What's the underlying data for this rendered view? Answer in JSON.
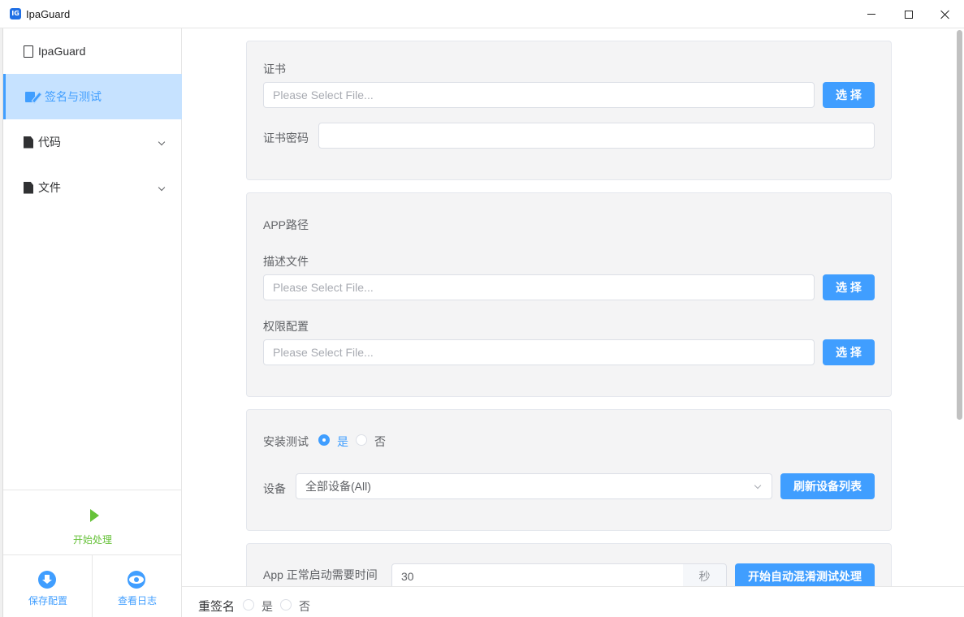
{
  "window": {
    "title": "IpaGuard",
    "logo_text": "IG"
  },
  "sidebar": {
    "items": [
      {
        "label": "IpaGuard"
      },
      {
        "label": "签名与测试"
      },
      {
        "label": "代码"
      },
      {
        "label": "文件"
      }
    ],
    "start_label": "开始处理",
    "save_label": "保存配置",
    "log_label": "查看日志"
  },
  "certificate": {
    "title": "证书",
    "file_placeholder": "Please Select File...",
    "select_button": "选 择",
    "password_label": "证书密码",
    "password_value": ""
  },
  "app_path": {
    "title": "APP路径",
    "profile_label": "描述文件",
    "profile_placeholder": "Please Select File...",
    "profile_button": "选 择",
    "entitlements_label": "权限配置",
    "entitlements_placeholder": "Please Select File...",
    "entitlements_button": "选 择"
  },
  "install_test": {
    "label": "安装测试",
    "yes": "是",
    "no": "否",
    "selected": "yes",
    "device_label": "设备",
    "device_value": "全部设备(All)",
    "refresh_button": "刷新设备列表"
  },
  "auto_test": {
    "startup_label": "App 正常启动需要时间",
    "startup_value": "30",
    "unit": "秒",
    "start_button": "开始自动混淆测试处理"
  },
  "footer": {
    "resign_label": "重签名",
    "yes": "是",
    "no": "否"
  },
  "colors": {
    "accent": "#409eff",
    "active_bg": "#c6e2ff",
    "start_green": "#67c23a",
    "card_bg": "#f4f4f5"
  }
}
